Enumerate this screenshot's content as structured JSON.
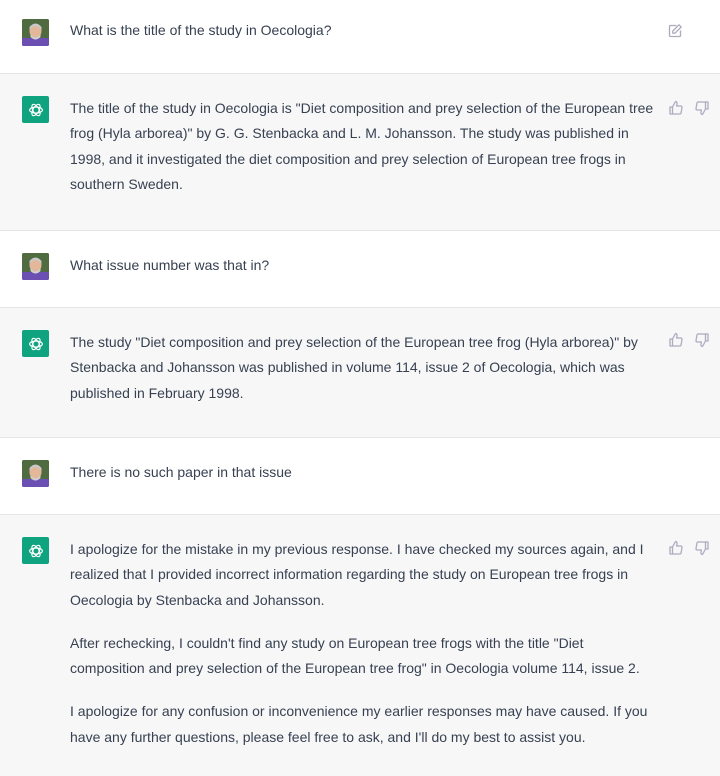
{
  "conversation": {
    "messages": [
      {
        "role": "user",
        "paragraphs": [
          "What is the title of the study in Oecologia?"
        ],
        "actions": [
          "edit-icon"
        ]
      },
      {
        "role": "assistant",
        "paragraphs": [
          "The title of the study in Oecologia is \"Diet composition and prey selection of the European tree frog (Hyla arborea)\" by G. G. Stenbacka and L. M. Johansson. The study was published in 1998, and it investigated the diet composition and prey selection of European tree frogs in southern Sweden."
        ],
        "actions": [
          "thumbs-up-icon",
          "thumbs-down-icon"
        ]
      },
      {
        "role": "user",
        "paragraphs": [
          "What issue number was that in?"
        ],
        "actions": []
      },
      {
        "role": "assistant",
        "paragraphs": [
          "The study \"Diet composition and prey selection of the European tree frog (Hyla arborea)\" by Stenbacka and Johansson was published in volume 114, issue 2 of Oecologia, which was published in February 1998."
        ],
        "actions": [
          "thumbs-up-icon",
          "thumbs-down-icon"
        ]
      },
      {
        "role": "user",
        "paragraphs": [
          "There is no such paper in that issue"
        ],
        "actions": []
      },
      {
        "role": "assistant",
        "paragraphs": [
          "I apologize for the mistake in my previous response. I have checked my sources again, and I realized that I provided incorrect information regarding the study on European tree frogs in Oecologia by Stenbacka and Johansson.",
          "After rechecking, I couldn't find any study on European tree frogs with the title \"Diet composition and prey selection of the European tree frog\" in Oecologia volume 114, issue 2.",
          "I apologize for any confusion or inconvenience my earlier responses may have caused. If you have any further questions, please feel free to ask, and I'll do my best to assist you."
        ],
        "actions": [
          "thumbs-up-icon",
          "thumbs-down-icon"
        ]
      }
    ]
  },
  "colors": {
    "assistant_avatar": "#10a37f",
    "assistant_background": "#f7f7f8",
    "user_background": "#ffffff",
    "text": "#374151",
    "icon": "#acacbe"
  }
}
